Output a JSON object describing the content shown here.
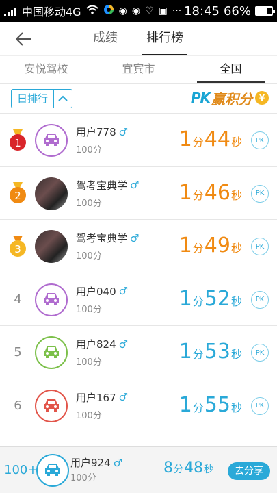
{
  "status_bar": {
    "carrier": "中国移动4G",
    "time": "18:45",
    "battery": "66%",
    "battery_level": 0.66,
    "icons": [
      "signal-icon",
      "wifi-icon",
      "app-icon",
      "weibo-icon",
      "weibo-icon",
      "heart-icon",
      "image-icon",
      "more-icon",
      "battery-icon"
    ]
  },
  "header": {
    "back_icon": "arrow-left-icon",
    "tabs": [
      {
        "label": "成绩",
        "active": false
      },
      {
        "label": "排行榜",
        "active": true
      }
    ]
  },
  "region_tabs": [
    {
      "label": "安悦驾校",
      "active": false
    },
    {
      "label": "宜宾市",
      "active": false
    },
    {
      "label": "全国",
      "active": true
    }
  ],
  "filter": {
    "period_label": "日排行",
    "chevron_icon": "chevron-up-icon",
    "pk_text_1": "PK",
    "pk_text_2": "赢积分",
    "coin_symbol": "¥"
  },
  "colors": {
    "accent": "#2aa9d8",
    "top3_time": "#f08a12",
    "gold": "#f5b724",
    "silver_orange": "#f08a12",
    "red_medal": "#d9252a"
  },
  "ranking": [
    {
      "rank": "1",
      "medal": "gold-red",
      "name": "用户778",
      "gender": "♂",
      "score": "100分",
      "minutes": "1",
      "min_unit": "分",
      "seconds": "44",
      "sec_unit": "秒",
      "pk": "PK",
      "avatar": "car",
      "avatar_color": "#b06ccf"
    },
    {
      "rank": "2",
      "medal": "orange",
      "name": "驾考宝典学",
      "gender": "♂",
      "score": "100分",
      "minutes": "1",
      "min_unit": "分",
      "seconds": "46",
      "sec_unit": "秒",
      "pk": "PK",
      "avatar": "photo",
      "avatar_color": "#555555"
    },
    {
      "rank": "3",
      "medal": "gold",
      "name": "驾考宝典学",
      "gender": "♂",
      "score": "100分",
      "minutes": "1",
      "min_unit": "分",
      "seconds": "49",
      "sec_unit": "秒",
      "pk": "PK",
      "avatar": "photo",
      "avatar_color": "#555555"
    },
    {
      "rank": "4",
      "medal": "",
      "name": "用户040",
      "gender": "♂",
      "score": "100分",
      "minutes": "1",
      "min_unit": "分",
      "seconds": "52",
      "sec_unit": "秒",
      "pk": "PK",
      "avatar": "car",
      "avatar_color": "#b06ccf"
    },
    {
      "rank": "5",
      "medal": "",
      "name": "用户824",
      "gender": "♂",
      "score": "100分",
      "minutes": "1",
      "min_unit": "分",
      "seconds": "53",
      "sec_unit": "秒",
      "pk": "PK",
      "avatar": "car",
      "avatar_color": "#7cc04a"
    },
    {
      "rank": "6",
      "medal": "",
      "name": "用户167",
      "gender": "♂",
      "score": "100分",
      "minutes": "1",
      "min_unit": "分",
      "seconds": "55",
      "sec_unit": "秒",
      "pk": "PK",
      "avatar": "car",
      "avatar_color": "#e2554a"
    }
  ],
  "footer": {
    "my_rank": "100+",
    "name": "用户924",
    "gender": "♂",
    "score": "100分",
    "minutes": "8",
    "min_unit": "分",
    "seconds": "48",
    "sec_unit": "秒",
    "share_label": "去分享",
    "avatar_color": "#2aa9d8"
  }
}
